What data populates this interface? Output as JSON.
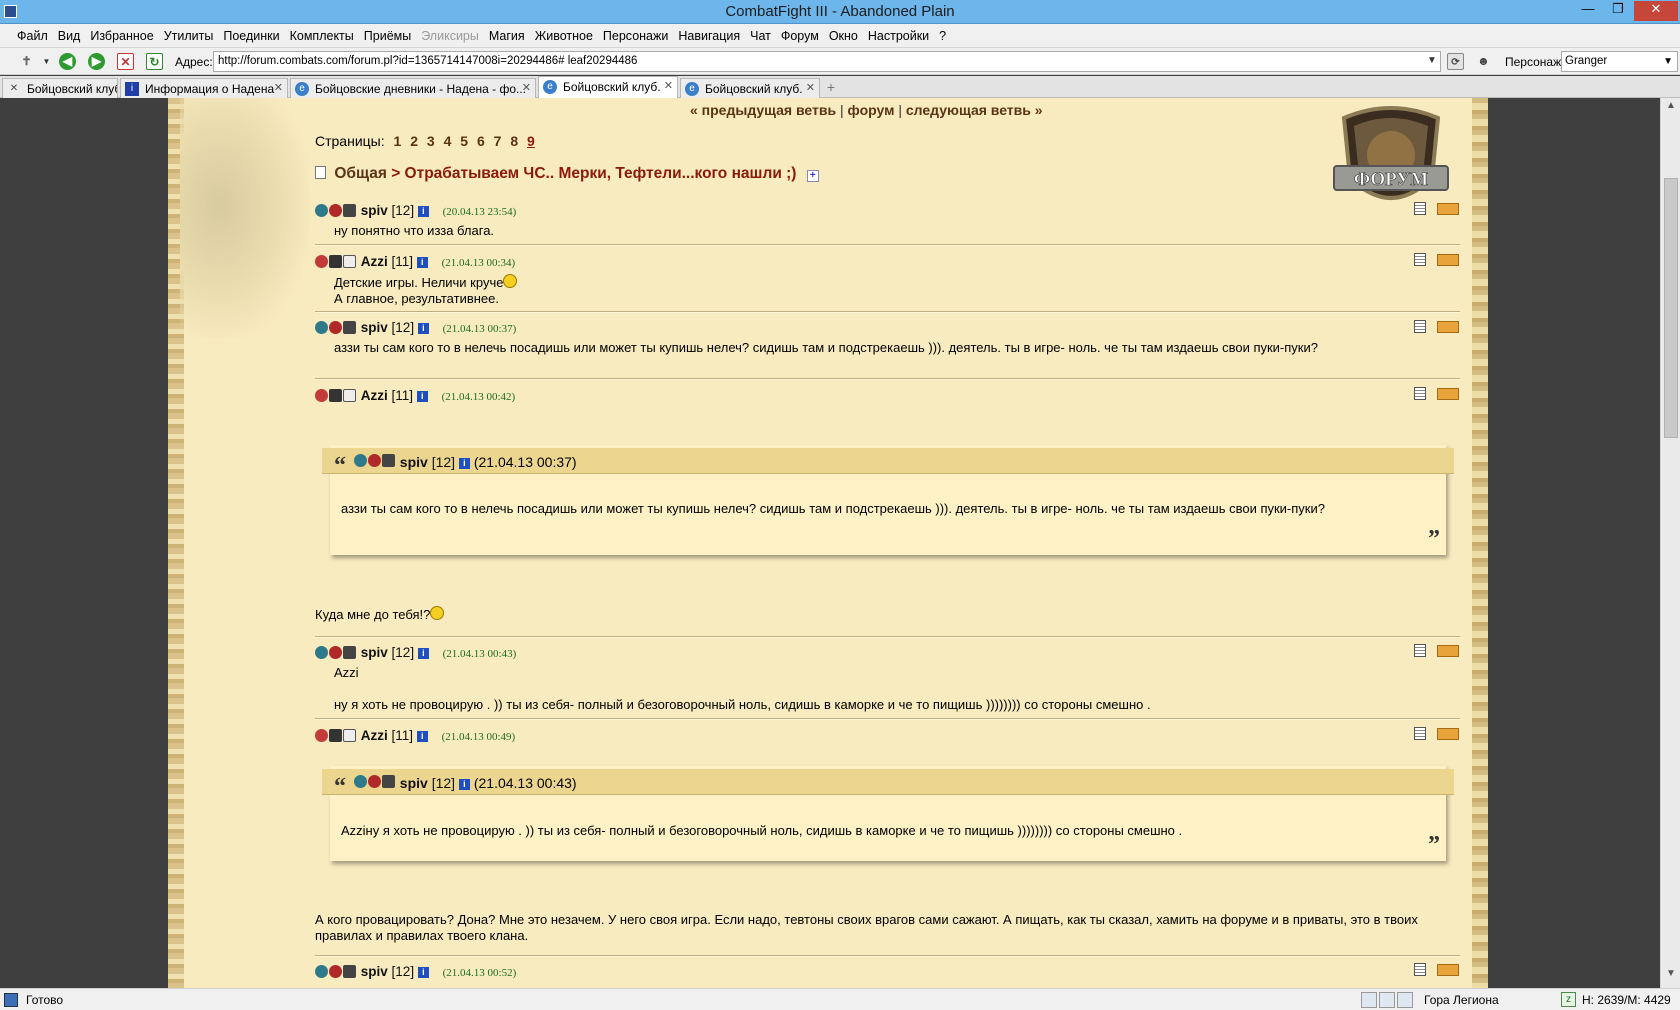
{
  "window": {
    "title": "CombatFight III - Abandoned Plain",
    "minimize": "—",
    "maximize": "❐",
    "close": "✕"
  },
  "menu": [
    "Файл",
    "Вид",
    "Избранное",
    "Утилиты",
    "Поединки",
    "Комплекты",
    "Приёмы",
    "Эликсиры",
    "Магия",
    "Животное",
    "Персонажи",
    "Навигация",
    "Чат",
    "Форум",
    "Окно",
    "Настройки",
    "?"
  ],
  "menu_disabled": "Эликсиры",
  "toolbar": {
    "address_label": "Адрес:",
    "address_value": "http://forum.combats.com/forum.pl?id=1365714147008i=20294486# leaf20294486",
    "character_label": "Персонаж:",
    "character_value": "Granger"
  },
  "tabs": [
    {
      "label": "Бойцовский клуб",
      "active": false
    },
    {
      "label": "Информация о Надена",
      "active": false
    },
    {
      "label": "Бойцовские дневники - Надена - фо...",
      "active": false
    },
    {
      "label": "Бойцовский клуб.",
      "active": true
    },
    {
      "label": "Бойцовский клуб.",
      "active": false
    }
  ],
  "forum": {
    "logo_text": "ФОРУМ",
    "nav": {
      "prev": "« предыдущая ветвь",
      "sep": "|",
      "forum": "форум",
      "next": "следующая ветвь »"
    },
    "pages_label": "Страницы:",
    "pages": [
      "1",
      "2",
      "3",
      "4",
      "5",
      "6",
      "7",
      "8",
      "9"
    ],
    "current_page": "9",
    "breadcrumb_root": "Общая",
    "breadcrumb_topic": "> Отрабатываем ЧС.. Мерки, Тефтели...кого нашли ;)"
  },
  "posts": [
    {
      "nick": "spiv",
      "level": "[12]",
      "time": "(20.04.13 23:54)",
      "body": "ну понятно что изза блага."
    },
    {
      "nick": "Azzi",
      "level": "[11]",
      "time": "(21.04.13 00:34)",
      "body1": "Детские игры. Неличи круче",
      "body2": "А главное, результативнее."
    },
    {
      "nick": "spiv",
      "level": "[12]",
      "time": "(21.04.13 00:37)",
      "body": "аззи ты сам кого то в нелечь посадишь или может ты купишь нелеч? сидишь там и подстрекаешь ))). деятель. ты в игре- ноль. че ты там издаешь свои пуки-пуки?"
    },
    {
      "nick": "Azzi",
      "level": "[11]",
      "time": "(21.04.13 00:42)",
      "quote": {
        "nick": "spiv",
        "level": "[12]",
        "time": "(21.04.13 00:37)",
        "body": "аззи ты сам кого то в нелечь посадишь или может ты купишь нелеч? сидишь там и подстрекаешь ))). деятель. ты в игре- ноль. че ты там издаешь свои пуки-пуки?"
      },
      "reply": "Куда мне до тебя!?"
    },
    {
      "nick": "spiv",
      "level": "[12]",
      "time": "(21.04.13 00:43)",
      "body1": "Azzi",
      "body2": "ну я хоть не провоцирую . )) ты из себя- полный и безоговорочный ноль, сидишь в каморке и че то пищишь )))))))) со стороны смешно ."
    },
    {
      "nick": "Azzi",
      "level": "[11]",
      "time": "(21.04.13 00:49)",
      "quote": {
        "nick": "spiv",
        "level": "[12]",
        "time": "(21.04.13 00:43)",
        "body": "Azziну я хоть не провоцирую . )) ты из себя- полный и безоговорочный ноль, сидишь в каморке и че то пищишь )))))))) со стороны смешно ."
      },
      "reply": "А кого провацировать? Дона? Мне это незачем. У него своя игра. Если надо, тевтоны своих врагов сами сажают. А пищать, как ты сказал, хамить на форуме и в приваты, это в твоих правилах и правилах твоего клана."
    },
    {
      "nick": "spiv",
      "level": "[12]",
      "time": "(21.04.13 00:52)"
    }
  ],
  "statusbar": {
    "status": "Готово",
    "location": "Гора Легиона",
    "hp": "Н: 2639/М: 4429"
  },
  "colors": {
    "parchment": "#f8ebbf",
    "link_brown": "#5a3416",
    "topic_red": "#8b1a0a",
    "timestamp_green": "#1d6d1d"
  }
}
